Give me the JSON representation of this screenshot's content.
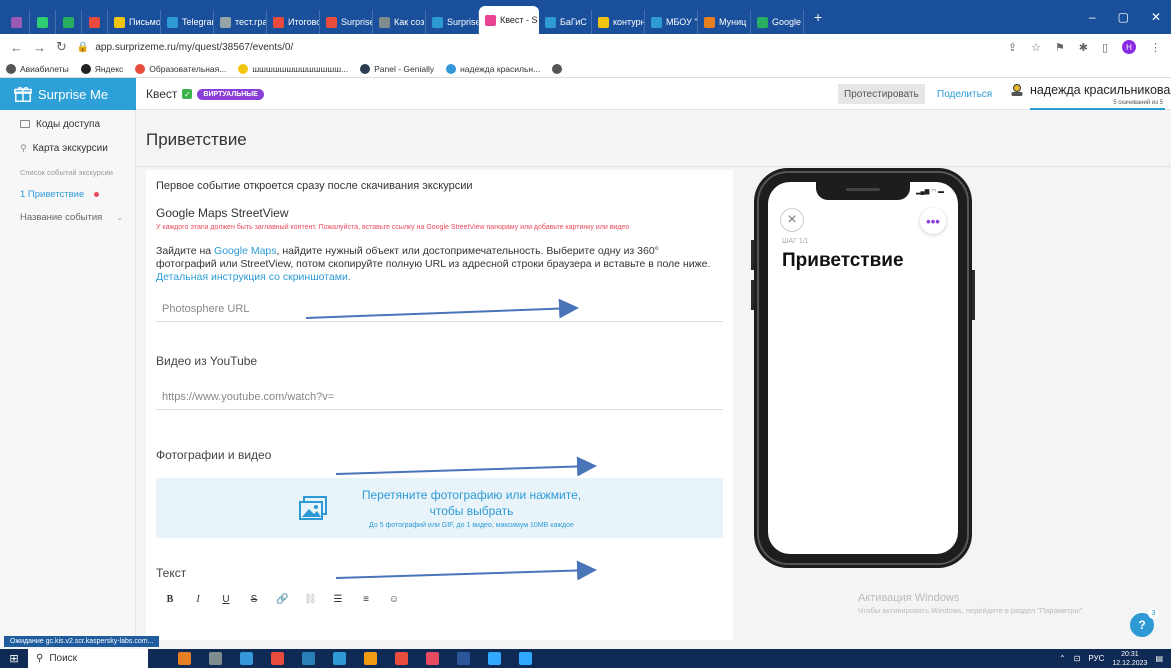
{
  "browser": {
    "tabs": [
      {
        "label": "",
        "color": "#9b59b6",
        "pinned": true
      },
      {
        "label": "",
        "color": "#2ecc71",
        "pinned": true
      },
      {
        "label": "",
        "color": "#27ae60",
        "pinned": true
      },
      {
        "label": "",
        "color": "#e74c3c",
        "pinned": true
      },
      {
        "label": "Письмо",
        "color": "#f1c40f"
      },
      {
        "label": "Telegram",
        "color": "#2d9ad6"
      },
      {
        "label": "тест.гра",
        "color": "#95a5a6"
      },
      {
        "label": "Итогово",
        "color": "#e74c3c"
      },
      {
        "label": "Surprise",
        "color": "#e74c3c"
      },
      {
        "label": "Как соз",
        "color": "#7f8c8d"
      },
      {
        "label": "Surprise",
        "color": "#2d9ad6"
      },
      {
        "label": "Квест - S",
        "color": "#e84393",
        "active": true
      },
      {
        "label": "БаГиС",
        "color": "#2d9ad6"
      },
      {
        "label": "контурн",
        "color": "#f1c40f"
      },
      {
        "label": "МБОУ \"Г",
        "color": "#2d9ad6"
      },
      {
        "label": "Муниц",
        "color": "#e67e22"
      },
      {
        "label": "Google",
        "color": "#27ae60"
      }
    ],
    "new_tab": "+",
    "url": "app.surprizeme.ru/my/quest/38567/events/0/",
    "bookmarks": [
      {
        "label": "Авиабилеты",
        "color": "#555"
      },
      {
        "label": "Яндекс",
        "color": "#222"
      },
      {
        "label": "Образовательная...",
        "color": "#e74c3c"
      },
      {
        "label": "шшшшшшшшшшшшш...",
        "color": "#f1c40f"
      },
      {
        "label": "Panel - Genially",
        "color": "#2c3e50"
      },
      {
        "label": "надежда красильн...",
        "color": "#3498db"
      },
      {
        "label": "",
        "color": "#555"
      }
    ],
    "profile_initial": "Н"
  },
  "header": {
    "logo": "Surprise Me",
    "quest_label": "Квест",
    "quest_badge": "ВИРТУАЛЬНЫЕ",
    "test_button": "Протестировать",
    "share_link": "Поделиться",
    "user_name": "надежда красильникова",
    "downloads": "5 скачиваний из 5"
  },
  "sidebar": {
    "items": [
      {
        "label": "Коды доступа"
      },
      {
        "label": "Карта экскурсии"
      }
    ],
    "section_title": "Список событий экскурсии",
    "events": [
      {
        "label": "1 Приветствие",
        "active": true
      },
      {
        "label": "Название события"
      }
    ]
  },
  "main": {
    "page_title": "Приветствие",
    "intro": "Первое событие откроется сразу после скачивания экскурсии",
    "streetview": {
      "title": "Google Maps StreetView",
      "warning": "У каждого этапа должен быть заглавный контент. Пожалуйста, вставьте ссылку на Google StreetView панораму или добавьте картинку или видео",
      "desc_before": "Зайдите на ",
      "desc_link": "Google Maps",
      "desc_after": ", найдите нужный объект или достопримечательность. Выберите одну из 360° фотографий или StreetView, потом скопируйте полную URL из адресной строки браузера и вставьте в поле ниже. ",
      "desc_link2": "Детальная инструкция со скриншотами.",
      "placeholder": "Photosphere URL"
    },
    "youtube": {
      "label": "Видео из YouTube",
      "placeholder": "https://www.youtube.com/watch?v="
    },
    "media": {
      "label": "Фотографии и видео",
      "drop_text_1": "Перетяните фотографию или нажмите,",
      "drop_text_2": "чтобы выбрать",
      "drop_hint": "До 5 фотографий или GIF, до 1 видео, максимум 10MB каждое"
    },
    "text_section": {
      "label": "Текст",
      "toolbar": [
        "B",
        "I",
        "U",
        "S",
        "🔗",
        "⛓",
        "☰",
        "≡",
        "☺"
      ]
    }
  },
  "phone": {
    "step": "ШАГ 1/1",
    "title": "Приветствие",
    "more": "•••",
    "close": "×"
  },
  "watermark": {
    "title": "Активация Windows",
    "subtitle": "Чтобы активировать Windows, перейдите в раздел \"Параметры\"."
  },
  "help": {
    "label": "?",
    "badge": "3"
  },
  "status_text": "Ожидание gc.kis.v2.scr.kaspersky-labs.com...",
  "taskbar": {
    "search": "Поиск",
    "lang": "РУС",
    "time": "20:31",
    "date": "12.12.2023"
  },
  "colors": {
    "accent": "#2d9ad6",
    "badge": "#8b3fd9",
    "warning": "#e84a5f",
    "arrow": "#4a74b8"
  }
}
